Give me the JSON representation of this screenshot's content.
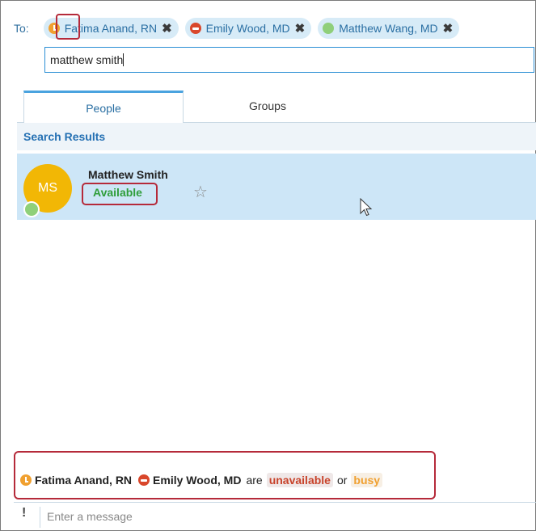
{
  "to_label": "To:",
  "recipients": [
    {
      "name": "Fatima Anand, RN",
      "status": "away"
    },
    {
      "name": "Emily Wood, MD",
      "status": "busy"
    },
    {
      "name": "Matthew Wang, MD",
      "status": "available"
    }
  ],
  "remove_glyph": "✖",
  "search": {
    "value": "matthew smith"
  },
  "tabs": [
    "People",
    "Groups"
  ],
  "search_results_header": "Search Results",
  "result": {
    "initials": "MS",
    "name": "Matthew Smith",
    "status": "Available",
    "star_glyph": "☆"
  },
  "notice": {
    "names": [
      "Fatima Anand, RN",
      "Emily Wood, MD"
    ],
    "are": "are",
    "unavailable": "unavailable",
    "or": "or",
    "busy": "busy"
  },
  "message": {
    "icon_glyph": "!",
    "placeholder": "Enter a message"
  },
  "colors": {
    "away": "#f0a030",
    "busy": "#d9472b",
    "available": "#8fcf7a",
    "accent": "#2b8fd4",
    "highlight": "#b52a3a"
  }
}
